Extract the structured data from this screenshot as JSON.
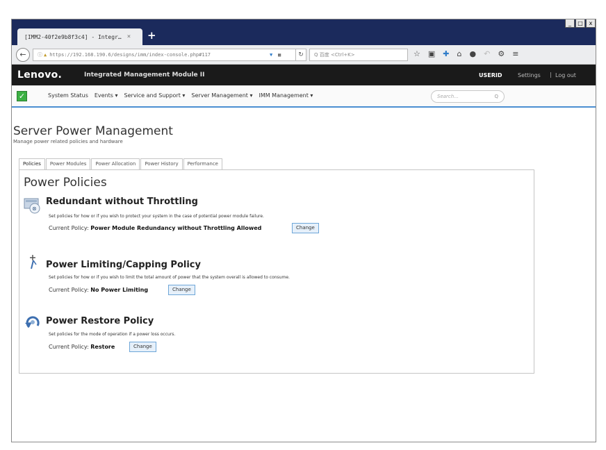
{
  "browser": {
    "tab_title": "[IMM2-40f2e9b8f3c4] - Integr…",
    "tab_close": "×",
    "new_tab": "+",
    "window_controls": [
      "_",
      "□",
      "x"
    ],
    "url": "https://192.168.190.6/designs/imm/index-console.php#117",
    "search_placeholder": "Q 百度 <Ctrl+K>",
    "icons": [
      "back-icon",
      "info-icon",
      "lock-icon",
      "shield-icon",
      "grid-icon",
      "reload-icon",
      "star-icon",
      "clipboard-icon",
      "download-icon",
      "home-icon",
      "chat-icon",
      "undo-icon",
      "tools-icon",
      "menu-icon"
    ]
  },
  "header": {
    "logo": "Lenovo.",
    "app_name": "Integrated Management Module II",
    "user": "USERID",
    "settings": "Settings",
    "separator": "|",
    "logout": "Log out"
  },
  "menu": {
    "items": [
      "System Status",
      "Events ▾",
      "Service and Support ▾",
      "Server Management ▾",
      "IMM Management ▾"
    ],
    "search_placeholder": "Search...",
    "search_icon": "Q"
  },
  "page": {
    "title": "Server Power Management",
    "subtitle": "Manage power related policies and hardware",
    "tabs": [
      "Policies",
      "Power Modules",
      "Power Allocation",
      "Power History",
      "Performance"
    ],
    "active_tab": "Policies",
    "section_title": "Power Policies",
    "policies": [
      {
        "title": "Redundant without Throttling",
        "description": "Set policies for how or if you wish to protect your system in the case of potential power module failure.",
        "current_label": "Current Policy:",
        "current_value": "Power Module Redundancy without Throttling Allowed",
        "button": "Change",
        "icon": "power-modules-icon"
      },
      {
        "title": "Power Limiting/Capping Policy",
        "description": "Set policies for how or if you wish to limit the total amount of power that the system overall is allowed to consume.",
        "current_label": "Current Policy:",
        "current_value": "No Power Limiting",
        "button": "Change",
        "icon": "power-cap-icon"
      },
      {
        "title": "Power Restore Policy",
        "description": "Set policies for the mode of operation if a power loss occurs.",
        "current_label": "Current Policy:",
        "current_value": "Restore",
        "button": "Change",
        "icon": "power-restore-icon"
      }
    ]
  }
}
